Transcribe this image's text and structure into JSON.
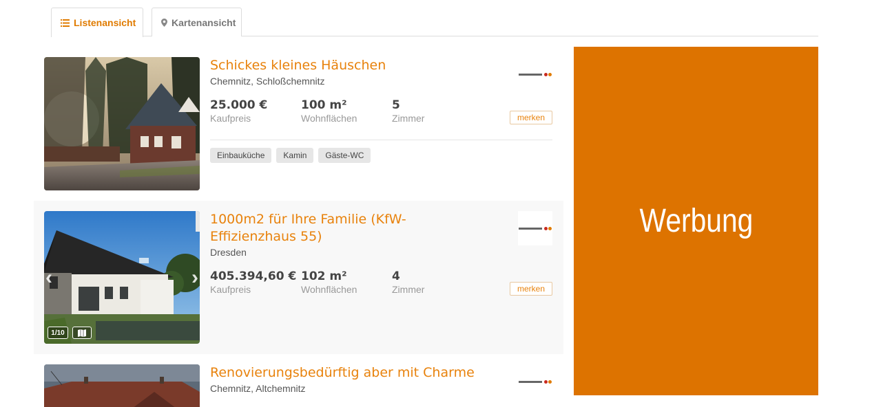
{
  "tabs": [
    {
      "label": "Listenansicht",
      "icon": "list-icon",
      "active": true
    },
    {
      "label": "Kartenansicht",
      "icon": "map-pin-icon",
      "active": false
    }
  ],
  "listings": [
    {
      "title": "Schickes kleines Häuschen",
      "location": "Chemnitz, Schloßchemnitz",
      "price": "25.000 €",
      "price_label": "Kaufpreis",
      "area": "100 m²",
      "area_label": "Wohnflächen",
      "rooms": "5",
      "rooms_label": "Zimmer",
      "save_label": "merken",
      "tags": [
        "Einbauküche",
        "Kamin",
        "Gäste-WC"
      ]
    },
    {
      "title_line1": "1000m2 für Ihre Familie (KfW-",
      "title_line2": "Effizienzhaus 55)",
      "location": "Dresden",
      "price": "405.394,60 €",
      "price_label": "Kaufpreis",
      "area": "102 m²",
      "area_label": "Wohnflächen",
      "rooms": "4",
      "rooms_label": "Zimmer",
      "save_label": "merken",
      "image_counter": "1/10"
    },
    {
      "title": "Renovierungsbedürftig aber mit Charme",
      "location": "Chemnitz, Altchemnitz"
    }
  ],
  "ad": {
    "label": "Werbung",
    "color": "#dd7300"
  },
  "colors": {
    "accent": "#e8820c",
    "tab_active": "#e07b00"
  }
}
